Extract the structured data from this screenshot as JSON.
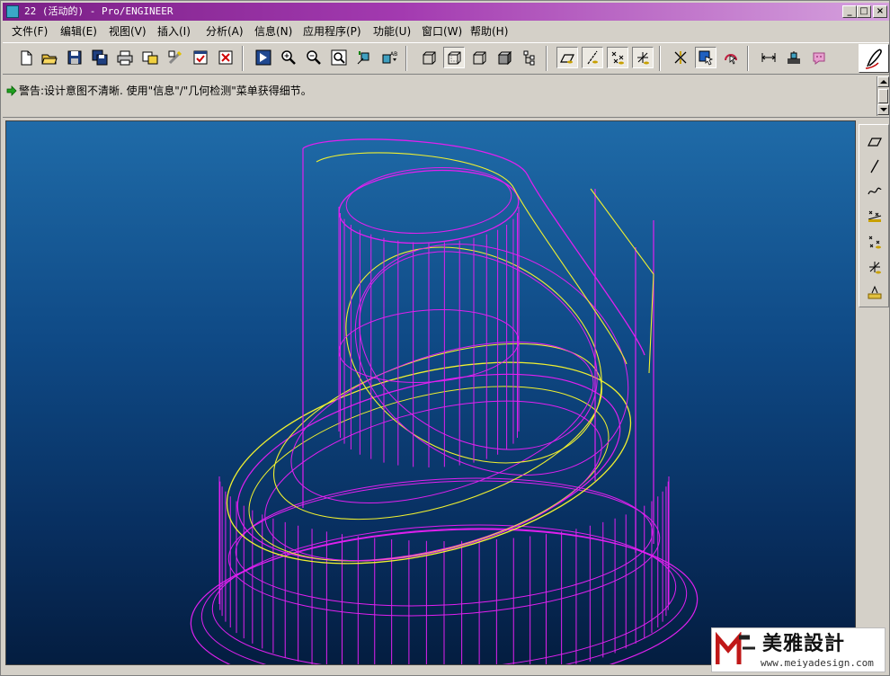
{
  "window": {
    "title": "22 (活动的) - Pro/ENGINEER",
    "controls": {
      "minimize": "_",
      "maximize": "□",
      "close": "×"
    }
  },
  "menu": [
    "文件(F)",
    "编辑(E)",
    "视图(V)",
    "插入(I)",
    "分析(A)",
    "信息(N)",
    "应用程序(P)",
    "功能(U)",
    "窗口(W)",
    "帮助(H)"
  ],
  "toolbar_icons": [
    "new-file-icon",
    "open-folder-icon",
    "save-icon",
    "save-copy-icon",
    "print-icon",
    "send-mail-icon",
    "regenerate-icon",
    "window-icon",
    "close-window-icon",
    "redraw-icon",
    "zoom-in-icon",
    "zoom-out-icon",
    "refit-icon",
    "orient-icon",
    "saved-views-icon",
    "wireframe-icon",
    "hidden-line-icon",
    "no-hidden-icon",
    "shaded-icon",
    "model-tree-icon",
    "datum-plane-icon",
    "datum-axis-icon",
    "datum-point-icon",
    "coordinate-system-icon",
    "spin-center-icon",
    "select-icon",
    "pick-icon",
    "measure-icon",
    "model-analysis-icon",
    "info-icon",
    "help-context-icon"
  ],
  "message": {
    "text": "警告:设计意图不清晰. 使用\"信息\"/\"几何检测\"菜单获得细节。"
  },
  "right_toolbar_icons": [
    "datum-plane-tool-icon",
    "datum-axis-tool-icon",
    "datum-curve-tool-icon",
    "datum-point-tool-icon",
    "offset-point-icon",
    "coordinate-tool-icon",
    "analysis-feature-icon"
  ],
  "watermark": {
    "name": "美雅設計",
    "url": "www.meiyadesign.com"
  },
  "colors": {
    "wire_primary": "#e020f0",
    "wire_highlight": "#f0f030",
    "title_bar": "#7a1f86",
    "viewport_top": "#1f6ba8",
    "viewport_bottom": "#041d40"
  }
}
